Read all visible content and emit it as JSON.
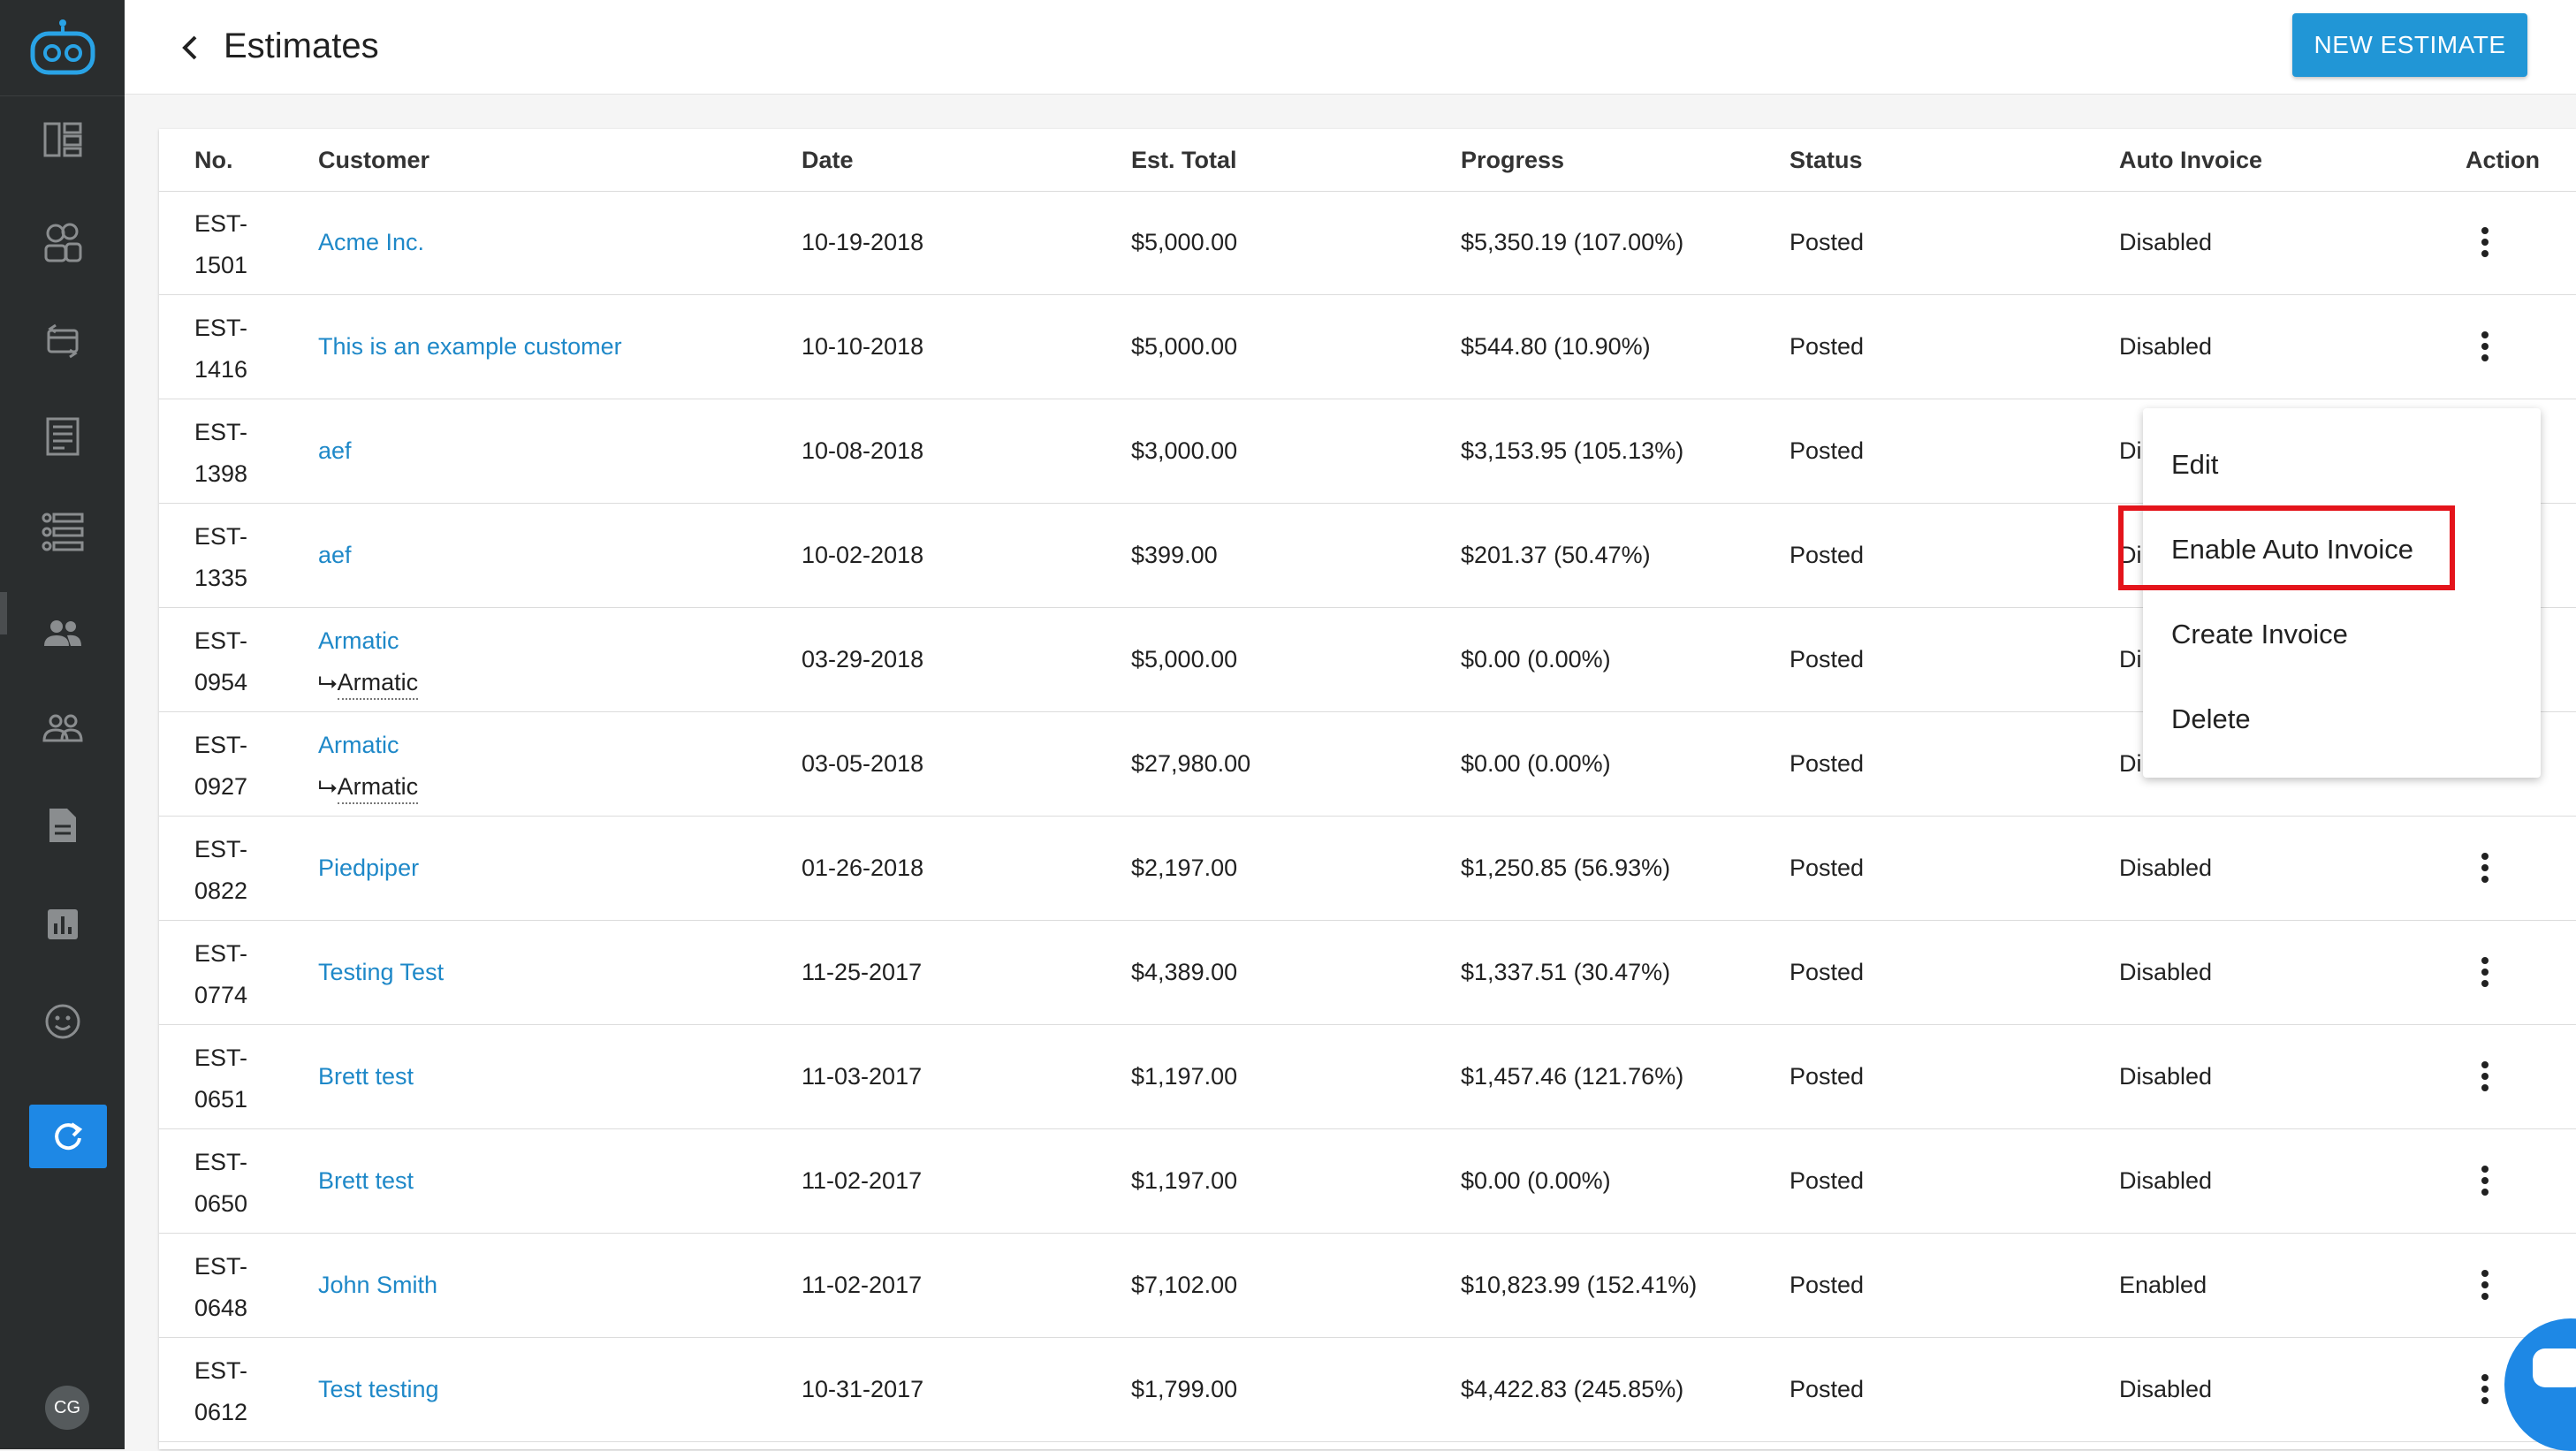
{
  "header": {
    "title": "Estimates",
    "new_button": "NEW ESTIMATE"
  },
  "user": {
    "initials": "CG"
  },
  "table": {
    "columns": [
      "No.",
      "Customer",
      "Date",
      "Est. Total",
      "Progress",
      "Status",
      "Auto Invoice",
      "Action"
    ],
    "rows": [
      {
        "no1": "EST-",
        "no2": "1501",
        "customer": "Acme Inc.",
        "sub": "",
        "date": "10-19-2018",
        "total": "$5,000.00",
        "progress": "$5,350.19 (107.00%)",
        "status": "Posted",
        "auto": "Disabled"
      },
      {
        "no1": "EST-",
        "no2": "1416",
        "customer": "This is an example customer",
        "sub": "",
        "date": "10-10-2018",
        "total": "$5,000.00",
        "progress": "$544.80 (10.90%)",
        "status": "Posted",
        "auto": "Disabled"
      },
      {
        "no1": "EST-",
        "no2": "1398",
        "customer": "aef",
        "sub": "",
        "date": "10-08-2018",
        "total": "$3,000.00",
        "progress": "$3,153.95 (105.13%)",
        "status": "Posted",
        "auto": "Di"
      },
      {
        "no1": "EST-",
        "no2": "1335",
        "customer": "aef",
        "sub": "",
        "date": "10-02-2018",
        "total": "$399.00",
        "progress": "$201.37 (50.47%)",
        "status": "Posted",
        "auto": "Di"
      },
      {
        "no1": "EST-",
        "no2": "0954",
        "customer": "Armatic",
        "sub": "Armatic",
        "date": "03-29-2018",
        "total": "$5,000.00",
        "progress": "$0.00 (0.00%)",
        "status": "Posted",
        "auto": "Di"
      },
      {
        "no1": "EST-",
        "no2": "0927",
        "customer": "Armatic",
        "sub": "Armatic",
        "date": "03-05-2018",
        "total": "$27,980.00",
        "progress": "$0.00 (0.00%)",
        "status": "Posted",
        "auto": "Di"
      },
      {
        "no1": "EST-",
        "no2": "0822",
        "customer": "Piedpiper",
        "sub": "",
        "date": "01-26-2018",
        "total": "$2,197.00",
        "progress": "$1,250.85 (56.93%)",
        "status": "Posted",
        "auto": "Disabled"
      },
      {
        "no1": "EST-",
        "no2": "0774",
        "customer": "Testing Test",
        "sub": "",
        "date": "11-25-2017",
        "total": "$4,389.00",
        "progress": "$1,337.51 (30.47%)",
        "status": "Posted",
        "auto": "Disabled"
      },
      {
        "no1": "EST-",
        "no2": "0651",
        "customer": "Brett test",
        "sub": "",
        "date": "11-03-2017",
        "total": "$1,197.00",
        "progress": "$1,457.46 (121.76%)",
        "status": "Posted",
        "auto": "Disabled"
      },
      {
        "no1": "EST-",
        "no2": "0650",
        "customer": "Brett test",
        "sub": "",
        "date": "11-02-2017",
        "total": "$1,197.00",
        "progress": "$0.00 (0.00%)",
        "status": "Posted",
        "auto": "Disabled"
      },
      {
        "no1": "EST-",
        "no2": "0648",
        "customer": "John Smith",
        "sub": "",
        "date": "11-02-2017",
        "total": "$7,102.00",
        "progress": "$10,823.99 (152.41%)",
        "status": "Posted",
        "auto": "Enabled"
      },
      {
        "no1": "EST-",
        "no2": "0612",
        "customer": "Test testing",
        "sub": "",
        "date": "10-31-2017",
        "total": "$1,799.00",
        "progress": "$4,422.83 (245.85%)",
        "status": "Posted",
        "auto": "Disabled"
      }
    ]
  },
  "menu": {
    "items": [
      "Edit",
      "Enable Auto Invoice",
      "Create Invoice",
      "Delete"
    ]
  },
  "colors": {
    "sidebar": "#2a2d2e",
    "accent": "#2196d6",
    "link": "#1e88c8",
    "highlight": "#e4141b"
  }
}
